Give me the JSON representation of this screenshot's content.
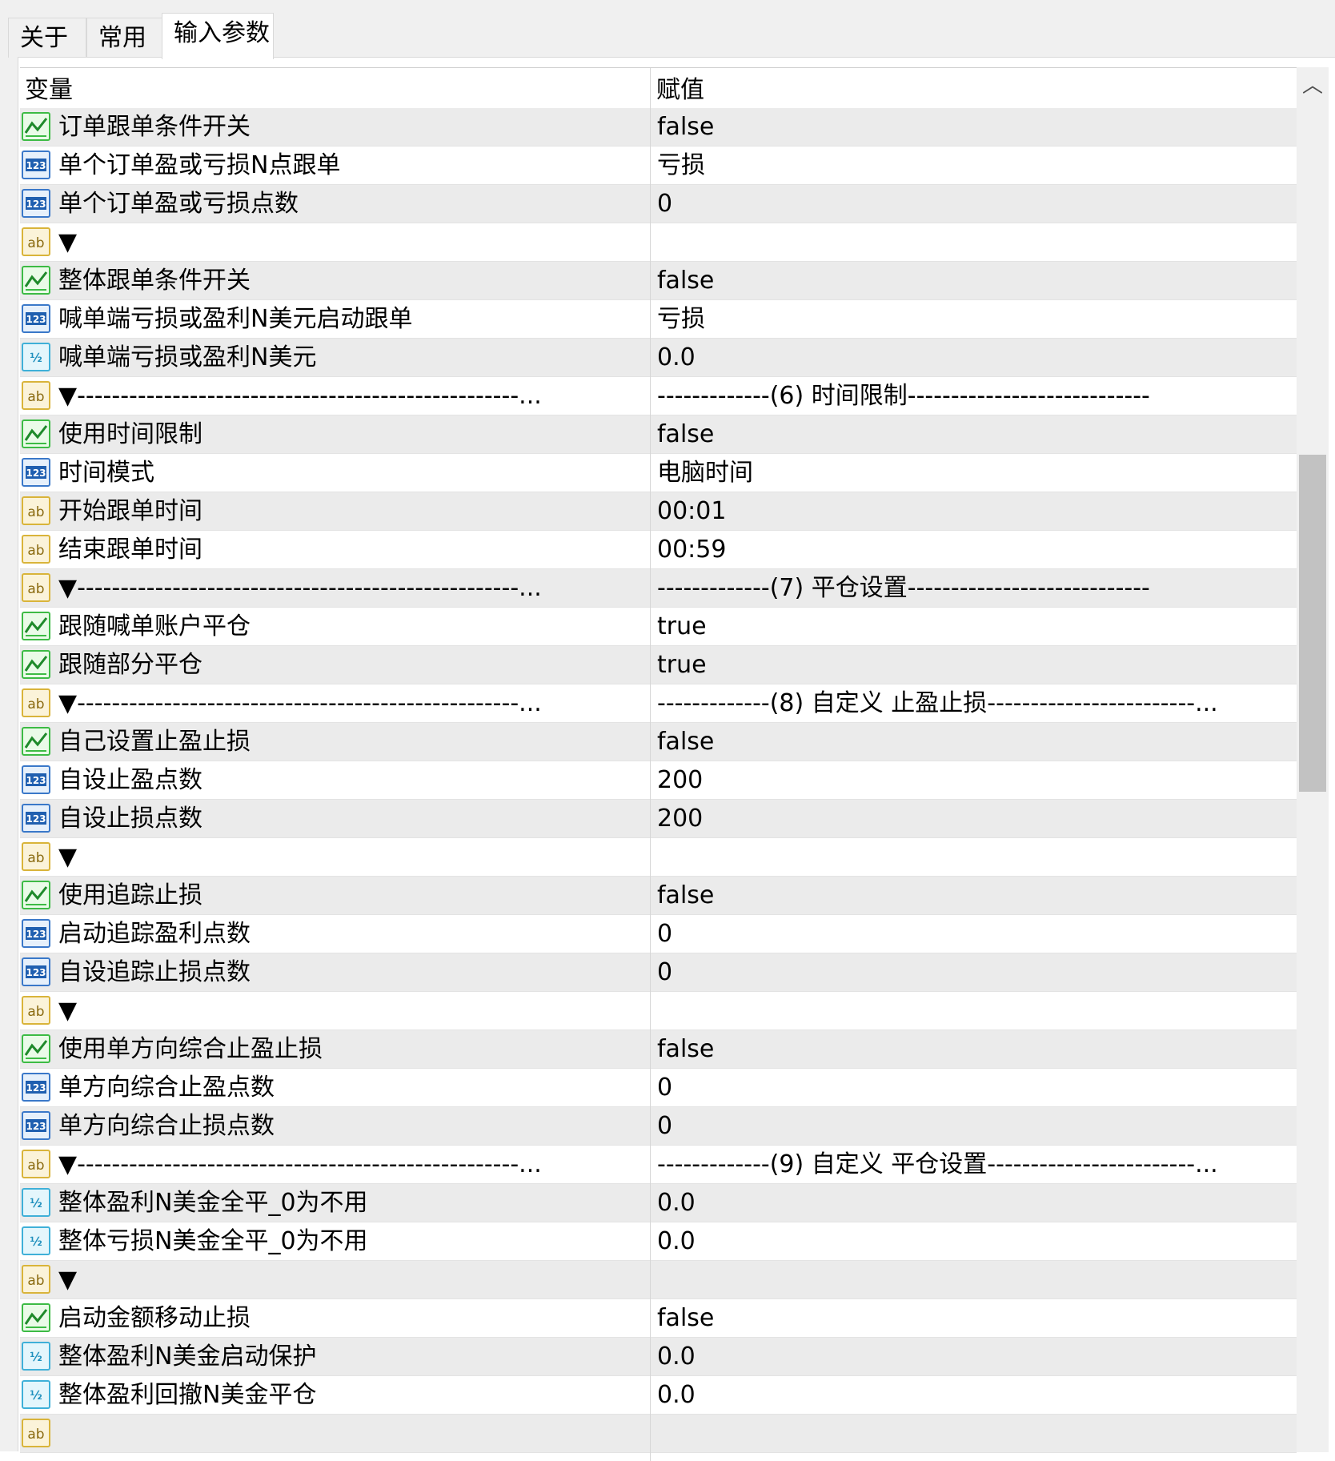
{
  "tabs": [
    {
      "label": "关于",
      "active": false
    },
    {
      "label": "常用",
      "active": false
    },
    {
      "label": "输入参数",
      "active": true
    }
  ],
  "table": {
    "col_variable": "变量",
    "col_value": "赋值",
    "rows": [
      {
        "icon": "bool",
        "name": "订单跟单条件开关",
        "value": "false"
      },
      {
        "icon": "int",
        "name": "单个订单盈或亏损N点跟单",
        "value": "亏损"
      },
      {
        "icon": "int",
        "name": "单个订单盈或亏损点数",
        "value": "0"
      },
      {
        "icon": "str",
        "name": "▼",
        "value": ""
      },
      {
        "icon": "bool",
        "name": "整体跟单条件开关",
        "value": "false"
      },
      {
        "icon": "int",
        "name": "喊单端亏损或盈利N美元启动跟单",
        "value": "亏损"
      },
      {
        "icon": "dbl",
        "name": "喊单端亏损或盈利N美元",
        "value": "0.0"
      },
      {
        "icon": "str",
        "name": "▼---------------------------------------------------...",
        "value": "-------------(6) 时间限制----------------------------"
      },
      {
        "icon": "bool",
        "name": "使用时间限制",
        "value": "false"
      },
      {
        "icon": "int",
        "name": "时间模式",
        "value": "电脑时间"
      },
      {
        "icon": "str",
        "name": "开始跟单时间",
        "value": "00:01"
      },
      {
        "icon": "str",
        "name": "结束跟单时间",
        "value": "00:59"
      },
      {
        "icon": "str",
        "name": "▼---------------------------------------------------...",
        "value": "-------------(7) 平仓设置----------------------------"
      },
      {
        "icon": "bool",
        "name": "跟随喊单账户平仓",
        "value": "true"
      },
      {
        "icon": "bool",
        "name": "跟随部分平仓",
        "value": "true"
      },
      {
        "icon": "str",
        "name": "▼---------------------------------------------------...",
        "value": "-------------(8) 自定义 止盈止损------------------------..."
      },
      {
        "icon": "bool",
        "name": "自己设置止盈止损",
        "value": "false"
      },
      {
        "icon": "int",
        "name": "自设止盈点数",
        "value": "200"
      },
      {
        "icon": "int",
        "name": "自设止损点数",
        "value": "200"
      },
      {
        "icon": "str",
        "name": "▼",
        "value": ""
      },
      {
        "icon": "bool",
        "name": "使用追踪止损",
        "value": "false"
      },
      {
        "icon": "int",
        "name": "启动追踪盈利点数",
        "value": "0"
      },
      {
        "icon": "int",
        "name": "自设追踪止损点数",
        "value": "0"
      },
      {
        "icon": "str",
        "name": "▼",
        "value": ""
      },
      {
        "icon": "bool",
        "name": "使用单方向综合止盈止损",
        "value": "false"
      },
      {
        "icon": "int",
        "name": "单方向综合止盈点数",
        "value": "0"
      },
      {
        "icon": "int",
        "name": "单方向综合止损点数",
        "value": "0"
      },
      {
        "icon": "str",
        "name": "▼---------------------------------------------------...",
        "value": "-------------(9) 自定义 平仓设置------------------------..."
      },
      {
        "icon": "dbl",
        "name": "整体盈利N美金全平_0为不用",
        "value": "0.0"
      },
      {
        "icon": "dbl",
        "name": "整体亏损N美金全平_0为不用",
        "value": "0.0"
      },
      {
        "icon": "str",
        "name": "▼",
        "value": ""
      },
      {
        "icon": "bool",
        "name": "启动金额移动止损",
        "value": "false"
      },
      {
        "icon": "dbl",
        "name": "整体盈利N美金启动保护",
        "value": "0.0"
      },
      {
        "icon": "dbl",
        "name": "整体盈利回撤N美金平仓",
        "value": "0.0"
      },
      {
        "icon": "str",
        "name": "",
        "value": ""
      }
    ]
  },
  "icons": {
    "bool": "bool-type-icon",
    "int": "integer-type-icon",
    "dbl": "double-type-icon",
    "str": "string-type-icon"
  },
  "scrollbar": {
    "thumb_start_fraction": 0.26,
    "thumb_size_fraction": 0.25
  },
  "colors": {
    "bool_icon": "#3dbb45",
    "int_icon": "#3a78c9",
    "dbl_icon": "#3fb0d8",
    "str_icon": "#d9b43a"
  }
}
